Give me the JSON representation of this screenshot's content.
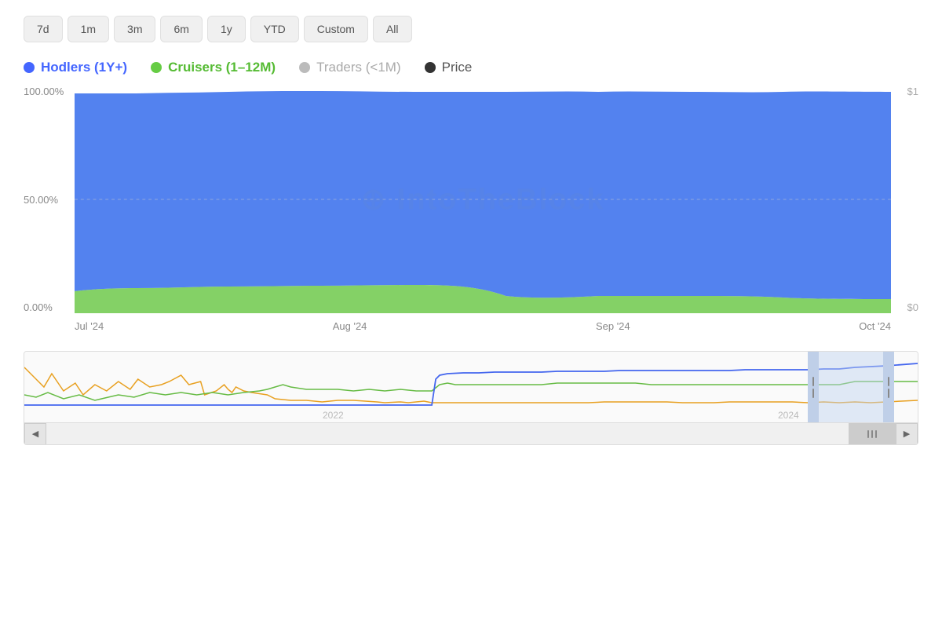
{
  "timeFilters": {
    "buttons": [
      "7d",
      "1m",
      "3m",
      "6m",
      "1y",
      "YTD",
      "Custom",
      "All"
    ]
  },
  "legend": {
    "items": [
      {
        "id": "hodlers",
        "label": "Hodlers (1Y+)",
        "color": "#4466ff",
        "cssClass": "legend-hodlers"
      },
      {
        "id": "cruisers",
        "label": "Cruisers (1–12M)",
        "color": "#66cc44",
        "cssClass": "legend-cruisers"
      },
      {
        "id": "traders",
        "label": "Traders (<1M)",
        "color": "#bbbbbb",
        "cssClass": "legend-traders"
      },
      {
        "id": "price",
        "label": "Price",
        "color": "#333333",
        "cssClass": "legend-price"
      }
    ]
  },
  "mainChart": {
    "yAxisLeft": [
      "100.00%",
      "50.00%",
      "0.00%"
    ],
    "yAxisRight": [
      "$1",
      "$0"
    ],
    "xAxisLabels": [
      "Jul '24",
      "Aug '24",
      "Sep '24",
      "Oct '24"
    ],
    "watermark": "⊕ IntoTheBlock"
  },
  "miniChart": {
    "yearLabels": [
      "2022",
      "2024"
    ],
    "scrollLeft": "◀",
    "scrollRight": "▶"
  }
}
